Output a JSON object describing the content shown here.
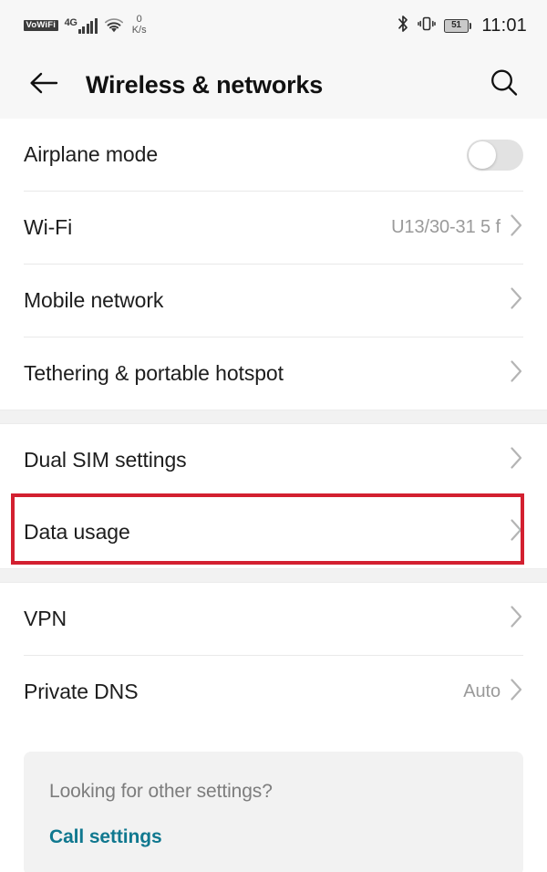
{
  "status_bar": {
    "vowifi_label": "VoWiFi",
    "network_type": "4G",
    "signal_bars": 5,
    "wifi_icon": "wifi-icon",
    "data_rate_value": "0",
    "data_rate_unit": "K/s",
    "bluetooth_icon": "bluetooth-icon",
    "vibrate_icon": "vibrate-icon",
    "battery_percent": "51",
    "time": "11:01"
  },
  "app_bar": {
    "back_icon": "back-arrow-icon",
    "title": "Wireless & networks",
    "search_icon": "search-icon"
  },
  "sections": [
    {
      "rows": [
        {
          "label": "Airplane mode",
          "value": "",
          "control": "toggle",
          "toggle_on": false
        },
        {
          "label": "Wi-Fi",
          "value": "U13/30-31 5 f",
          "control": "chevron"
        },
        {
          "label": "Mobile network",
          "value": "",
          "control": "chevron"
        },
        {
          "label": "Tethering & portable hotspot",
          "value": "",
          "control": "chevron"
        }
      ]
    },
    {
      "rows": [
        {
          "label": "Dual SIM settings",
          "value": "",
          "control": "chevron"
        },
        {
          "label": "Data usage",
          "value": "",
          "control": "chevron",
          "highlighted": true
        }
      ]
    },
    {
      "rows": [
        {
          "label": "VPN",
          "value": "",
          "control": "chevron"
        },
        {
          "label": "Private DNS",
          "value": "Auto",
          "control": "chevron"
        }
      ]
    }
  ],
  "footer": {
    "question": "Looking for other settings?",
    "link_label": "Call settings"
  },
  "colors": {
    "highlight": "#d32030",
    "link": "#10788f",
    "status_bar_bg": "#f7f7f7",
    "section_gap_bg": "#f2f2f2",
    "card_bg": "#f2f2f2"
  }
}
